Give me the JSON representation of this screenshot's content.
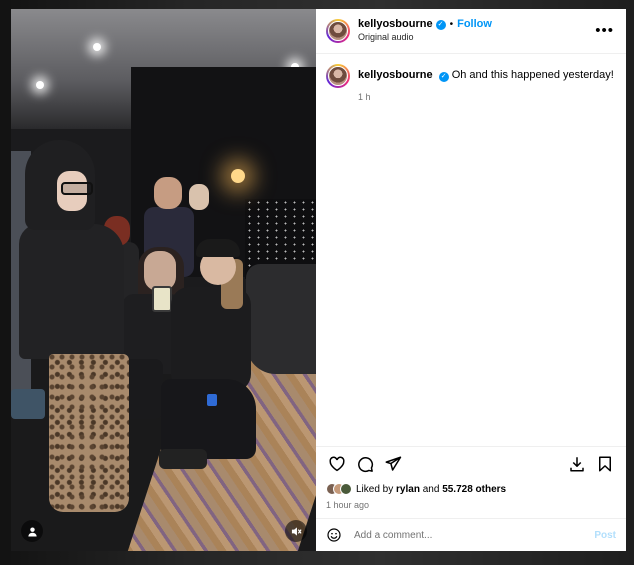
{
  "post": {
    "username": "kellyosbourne",
    "follow_label": "Follow",
    "audio": "Original audio",
    "caption": "Oh and this happened yesterday!",
    "caption_age": "1 h",
    "likes_prefix": "Liked by",
    "liked_by_user": "rylan",
    "likes_joiner": "and",
    "likes_count": "55.728 others",
    "time_ago": "1 hour ago",
    "comment_placeholder": "Add a comment...",
    "post_label": "Post",
    "more_label": "•••"
  },
  "icons": {
    "verified": "verified-badge-icon",
    "like": "heart-icon",
    "comment": "comment-bubble-icon",
    "share": "paper-plane-icon",
    "download": "download-icon",
    "save": "bookmark-icon",
    "emoji": "smiley-icon",
    "video_user": "user-icon",
    "mute": "mute-icon"
  },
  "colors": {
    "accent": "#0095f6",
    "post_disabled": "#b2dffc",
    "muted_text": "#737373"
  }
}
